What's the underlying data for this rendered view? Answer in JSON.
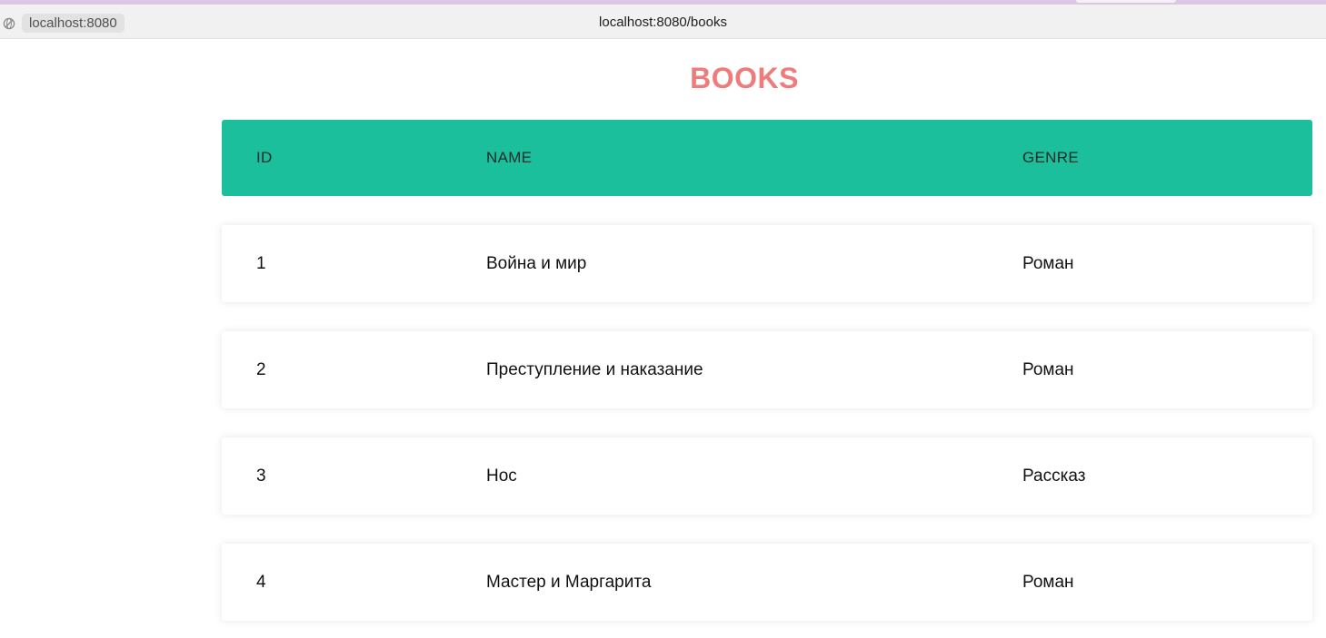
{
  "browser": {
    "site_chip": "localhost:8080",
    "url": "localhost:8080/books"
  },
  "page": {
    "title": "BOOKS",
    "columns": [
      "ID",
      "NAME",
      "GENRE"
    ],
    "rows": [
      {
        "id": "1",
        "name": "Война и мир",
        "genre": "Роман"
      },
      {
        "id": "2",
        "name": "Преступление и наказание",
        "genre": "Роман"
      },
      {
        "id": "3",
        "name": "Нос",
        "genre": "Рассказ"
      },
      {
        "id": "4",
        "name": "Мастер и Маргарита",
        "genre": "Роман"
      }
    ]
  },
  "colors": {
    "header_bg": "#1cbf9b",
    "title": "#ef7c7c"
  },
  "icons": {
    "site_info": "globe-icon"
  }
}
